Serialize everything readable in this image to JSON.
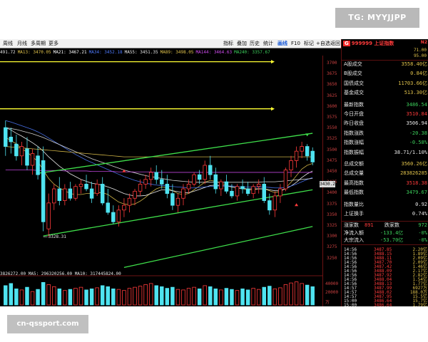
{
  "watermark_badge": "TG: MYYJJPP",
  "site_watermark": "cn-qssport.com",
  "toolbar": {
    "left_items": [
      "周线",
      "月线",
      "多周期",
      "更多"
    ],
    "right_items": [
      "指标",
      "叠加",
      "历史",
      "统计",
      "画线",
      "F10",
      "标记",
      "+自选",
      "返回"
    ],
    "active_item": "画线"
  },
  "ma_legend": [
    {
      "text": "491.72",
      "color": "#e6e6e6"
    },
    {
      "text": "MA13: 3470.05",
      "color": "#e0c24b"
    },
    {
      "text": "MA21: 3467.21",
      "color": "#ffffff"
    },
    {
      "text": "MA34: 3452.18",
      "color": "#4f7bff"
    },
    {
      "text": "MA55: 3451.35",
      "color": "#e6e6e6"
    },
    {
      "text": "MA89: 3498.05",
      "color": "#e0c24b"
    },
    {
      "text": "MA144: 3464.63",
      "color": "#d04cf0"
    },
    {
      "text": "MA240: 3357.67",
      "color": "#3ccf5b"
    }
  ],
  "price_axis": [
    "3700",
    "3675",
    "3650",
    "3625",
    "3600",
    "3575",
    "3550",
    "3525",
    "3500",
    "3475",
    "3450",
    "3425",
    "3400",
    "3375",
    "3350",
    "3325",
    "3300",
    "3275",
    "3250"
  ],
  "current_price_label": "3430.2",
  "low_annotation": "3328.31",
  "volume_legend": "3826272.00  MA5: 296320256.00  MA10: 317445824.00",
  "volume_axis": [
    "40000",
    "20000",
    "万"
  ],
  "panel": {
    "g_label": "G",
    "code": "999999 上证指数",
    "badge": "N2",
    "prices": [
      "71.00",
      "95.00"
    ],
    "stats": [
      {
        "label": "A股成交",
        "value": "3558.40亿",
        "color": "#e0c24b"
      },
      {
        "label": "B股成交",
        "value": "0.84亿",
        "color": "#e0c24b"
      },
      {
        "label": "国债成交",
        "value": "11703.66亿",
        "color": "#e0c24b"
      },
      {
        "label": "基金成交",
        "value": "513.30亿",
        "color": "#e0c24b"
      },
      {
        "label": "最新指数",
        "value": "3486.54",
        "color": "#3ccf5b"
      },
      {
        "label": "今日开盘",
        "value": "3510.84",
        "color": "#ff3b3b"
      },
      {
        "label": "昨日收盘",
        "value": "3506.94",
        "color": "#e6e6e6"
      },
      {
        "label": "指数涨跌",
        "value": "-20.38",
        "color": "#3ccf5b"
      },
      {
        "label": "指数涨幅",
        "value": "-0.58%",
        "color": "#3ccf5b"
      },
      {
        "label": "指数振幅",
        "value": "38.71/1.10%",
        "color": "#e6e6e6"
      },
      {
        "label": "总成交额",
        "value": "3560.26亿",
        "color": "#e0c24b"
      },
      {
        "label": "总成交量",
        "value": "283826285",
        "color": "#e0c24b"
      },
      {
        "label": "最高指数",
        "value": "3518.38",
        "color": "#ff3b3b"
      },
      {
        "label": "最低指数",
        "value": "3479.67",
        "color": "#3ccf5b"
      },
      {
        "label": "指数量比",
        "value": "0.92",
        "color": "#e6e6e6"
      },
      {
        "label": "上证换手",
        "value": "0.74%",
        "color": "#e6e6e6"
      }
    ],
    "breadth": {
      "up_label": "涨家数",
      "up_value": "891",
      "down_label": "跌家数",
      "down_value": "972"
    },
    "flows": [
      {
        "label": "净流入额",
        "value": "-133.4亿",
        "color": "#3ccf5b",
        "suffix": "-0%"
      },
      {
        "label": "大宗流入",
        "value": "-53.70亿",
        "color": "#3ccf5b",
        "suffix": "-0%"
      }
    ],
    "ticks": [
      {
        "time": "14:56",
        "price": "3487.85",
        "vol": "2.20亿"
      },
      {
        "time": "14:56",
        "price": "3488.15",
        "vol": "1.89亿"
      },
      {
        "time": "14:56",
        "price": "3488.11",
        "vol": "2.09亿"
      },
      {
        "time": "14:56",
        "price": "3487.70",
        "vol": "2.09亿"
      },
      {
        "time": "14:56",
        "price": "3487.42",
        "vol": "1.46亿"
      },
      {
        "time": "14:56",
        "price": "3488.09",
        "vol": "2.17亿"
      },
      {
        "time": "14:56",
        "price": "3487.92",
        "vol": "2.82亿"
      },
      {
        "time": "14:56",
        "price": "3488.04",
        "vol": "1.54亿"
      },
      {
        "time": "14:56",
        "price": "3488.13",
        "vol": "1.77亿"
      },
      {
        "time": "14:57",
        "price": "3487.99",
        "vol": "6927万"
      },
      {
        "time": "14:57",
        "price": "3488.02",
        "vol": "188.0万"
      },
      {
        "time": "14:57",
        "price": "3487.95",
        "vol": "15.5亿"
      },
      {
        "time": "15:00",
        "price": "3486.64",
        "vol": "15.7亿"
      },
      {
        "time": "15:00",
        "price": "3486.64",
        "vol": "1.79亿"
      }
    ]
  },
  "chart_data": {
    "type": "candlestick",
    "price_range": [
      3250,
      3710
    ],
    "candles": [
      {
        "o": 3560,
        "h": 3575,
        "l": 3500,
        "c": 3520
      },
      {
        "o": 3540,
        "h": 3560,
        "l": 3505,
        "c": 3530
      },
      {
        "o": 3525,
        "h": 3545,
        "l": 3490,
        "c": 3500
      },
      {
        "o": 3500,
        "h": 3530,
        "l": 3480,
        "c": 3520
      },
      {
        "o": 3515,
        "h": 3540,
        "l": 3470,
        "c": 3480
      },
      {
        "o": 3480,
        "h": 3515,
        "l": 3460,
        "c": 3505
      },
      {
        "o": 3500,
        "h": 3520,
        "l": 3450,
        "c": 3460
      },
      {
        "o": 3490,
        "h": 3520,
        "l": 3340,
        "c": 3360
      },
      {
        "o": 3345,
        "h": 3420,
        "l": 3328,
        "c": 3400
      },
      {
        "o": 3400,
        "h": 3440,
        "l": 3385,
        "c": 3430
      },
      {
        "o": 3430,
        "h": 3455,
        "l": 3395,
        "c": 3405
      },
      {
        "o": 3405,
        "h": 3440,
        "l": 3395,
        "c": 3430
      },
      {
        "o": 3430,
        "h": 3445,
        "l": 3405,
        "c": 3410
      },
      {
        "o": 3410,
        "h": 3440,
        "l": 3405,
        "c": 3435
      },
      {
        "o": 3435,
        "h": 3450,
        "l": 3420,
        "c": 3440
      },
      {
        "o": 3440,
        "h": 3460,
        "l": 3425,
        "c": 3430
      },
      {
        "o": 3430,
        "h": 3445,
        "l": 3400,
        "c": 3410
      },
      {
        "o": 3420,
        "h": 3450,
        "l": 3415,
        "c": 3440
      },
      {
        "o": 3440,
        "h": 3455,
        "l": 3395,
        "c": 3400
      },
      {
        "o": 3400,
        "h": 3430,
        "l": 3375,
        "c": 3380
      },
      {
        "o": 3380,
        "h": 3395,
        "l": 3355,
        "c": 3360
      },
      {
        "o": 3360,
        "h": 3395,
        "l": 3350,
        "c": 3385
      },
      {
        "o": 3385,
        "h": 3410,
        "l": 3370,
        "c": 3395
      },
      {
        "o": 3395,
        "h": 3420,
        "l": 3380,
        "c": 3410
      },
      {
        "o": 3410,
        "h": 3430,
        "l": 3395,
        "c": 3425
      },
      {
        "o": 3425,
        "h": 3450,
        "l": 3415,
        "c": 3440
      },
      {
        "o": 3440,
        "h": 3460,
        "l": 3430,
        "c": 3450
      },
      {
        "o": 3450,
        "h": 3475,
        "l": 3435,
        "c": 3465
      },
      {
        "o": 3465,
        "h": 3480,
        "l": 3440,
        "c": 3450
      },
      {
        "o": 3450,
        "h": 3470,
        "l": 3430,
        "c": 3440
      },
      {
        "o": 3440,
        "h": 3460,
        "l": 3410,
        "c": 3420
      },
      {
        "o": 3420,
        "h": 3440,
        "l": 3385,
        "c": 3395
      },
      {
        "o": 3395,
        "h": 3420,
        "l": 3380,
        "c": 3410
      },
      {
        "o": 3410,
        "h": 3440,
        "l": 3395,
        "c": 3430
      },
      {
        "o": 3430,
        "h": 3450,
        "l": 3420,
        "c": 3440
      },
      {
        "o": 3440,
        "h": 3465,
        "l": 3435,
        "c": 3460
      },
      {
        "o": 3460,
        "h": 3470,
        "l": 3440,
        "c": 3450
      },
      {
        "o": 3450,
        "h": 3490,
        "l": 3440,
        "c": 3480
      },
      {
        "o": 3480,
        "h": 3500,
        "l": 3450,
        "c": 3460
      },
      {
        "o": 3460,
        "h": 3475,
        "l": 3420,
        "c": 3430
      },
      {
        "o": 3430,
        "h": 3450,
        "l": 3415,
        "c": 3445
      },
      {
        "o": 3445,
        "h": 3460,
        "l": 3420,
        "c": 3425
      },
      {
        "o": 3425,
        "h": 3440,
        "l": 3410,
        "c": 3415
      },
      {
        "o": 3415,
        "h": 3440,
        "l": 3405,
        "c": 3435
      },
      {
        "o": 3435,
        "h": 3450,
        "l": 3420,
        "c": 3430
      },
      {
        "o": 3430,
        "h": 3445,
        "l": 3415,
        "c": 3420
      },
      {
        "o": 3420,
        "h": 3440,
        "l": 3410,
        "c": 3435
      },
      {
        "o": 3435,
        "h": 3450,
        "l": 3420,
        "c": 3440
      },
      {
        "o": 3440,
        "h": 3455,
        "l": 3400,
        "c": 3405
      },
      {
        "o": 3405,
        "h": 3420,
        "l": 3375,
        "c": 3385
      },
      {
        "o": 3385,
        "h": 3425,
        "l": 3370,
        "c": 3415
      },
      {
        "o": 3415,
        "h": 3440,
        "l": 3400,
        "c": 3430
      },
      {
        "o": 3430,
        "h": 3475,
        "l": 3425,
        "c": 3470
      },
      {
        "o": 3470,
        "h": 3500,
        "l": 3455,
        "c": 3490
      },
      {
        "o": 3490,
        "h": 3520,
        "l": 3475,
        "c": 3510
      },
      {
        "o": 3510,
        "h": 3530,
        "l": 3495,
        "c": 3520
      },
      {
        "o": 3520,
        "h": 3525,
        "l": 3490,
        "c": 3500
      },
      {
        "o": 3510,
        "h": 3518,
        "l": 3480,
        "c": 3487
      }
    ],
    "volume": [
      36,
      40,
      30,
      28,
      33,
      25,
      29,
      42,
      38,
      34,
      30,
      27,
      29,
      31,
      33,
      28,
      30,
      32,
      36,
      34,
      30,
      29,
      27,
      31,
      33,
      35,
      38,
      40,
      36,
      34,
      31,
      33,
      29,
      28,
      31,
      33,
      30,
      36,
      34,
      30,
      28,
      31,
      29,
      27,
      30,
      28,
      31,
      29,
      33,
      35,
      30,
      32,
      38,
      41,
      43,
      40,
      37,
      34
    ],
    "ma_lines": [
      {
        "name": "MA13",
        "color": "#e0c24b",
        "values": [
          3540,
          3532,
          3526,
          3515,
          3508,
          3498,
          3488,
          3470,
          3452,
          3440,
          3432,
          3426,
          3420,
          3418,
          3418,
          3420,
          3420,
          3422,
          3422,
          3418,
          3410,
          3402,
          3398,
          3396,
          3398,
          3404,
          3412,
          3422,
          3430,
          3434,
          3432,
          3426,
          3420,
          3418,
          3420,
          3428,
          3436,
          3444,
          3448,
          3446,
          3442,
          3438,
          3434,
          3432,
          3430,
          3428,
          3428,
          3430,
          3430,
          3426,
          3422,
          3424,
          3432,
          3444,
          3458,
          3472,
          3480,
          3484
        ]
      },
      {
        "name": "MA21",
        "color": "#ffffff",
        "values": [
          3560,
          3555,
          3548,
          3542,
          3535,
          3528,
          3520,
          3510,
          3498,
          3488,
          3478,
          3470,
          3462,
          3456,
          3450,
          3446,
          3442,
          3440,
          3438,
          3434,
          3430,
          3425,
          3420,
          3417,
          3415,
          3415,
          3416,
          3420,
          3424,
          3428,
          3428,
          3426,
          3424,
          3422,
          3422,
          3425,
          3429,
          3433,
          3437,
          3438,
          3437,
          3436,
          3434,
          3432,
          3431,
          3430,
          3430,
          3430,
          3430,
          3428,
          3426,
          3426,
          3430,
          3436,
          3444,
          3454,
          3462,
          3468
        ]
      },
      {
        "name": "MA34",
        "color": "#4f7bff",
        "values": [
          3575,
          3572,
          3568,
          3564,
          3560,
          3556,
          3551,
          3545,
          3538,
          3531,
          3524,
          3517,
          3510,
          3503,
          3497,
          3491,
          3486,
          3481,
          3476,
          3471,
          3466,
          3461,
          3456,
          3452,
          3448,
          3445,
          3442,
          3440,
          3438,
          3437,
          3436,
          3435,
          3434,
          3433,
          3432,
          3432,
          3433,
          3434,
          3435,
          3436,
          3436,
          3436,
          3436,
          3435,
          3434,
          3434,
          3434,
          3434,
          3434,
          3433,
          3432,
          3432,
          3433,
          3436,
          3440,
          3445,
          3450,
          3454
        ]
      },
      {
        "name": "MA55",
        "color": "#e6e6e6",
        "values": [
          3560,
          3558,
          3556,
          3553,
          3550,
          3547,
          3543,
          3539,
          3534,
          3529,
          3524,
          3519,
          3514,
          3509,
          3504,
          3499,
          3494,
          3490,
          3486,
          3482,
          3478,
          3474,
          3470,
          3467,
          3464,
          3461,
          3458,
          3456,
          3454,
          3452,
          3450,
          3448,
          3447,
          3446,
          3445,
          3444,
          3444,
          3444,
          3444,
          3444,
          3444,
          3444,
          3444,
          3444,
          3444,
          3444,
          3444,
          3444,
          3445,
          3445,
          3445,
          3446,
          3447,
          3448,
          3449,
          3450,
          3451,
          3452
        ]
      },
      {
        "name": "MA89",
        "color": "#e0c24b",
        "values": [
          3520,
          3519,
          3518,
          3517,
          3516,
          3515,
          3514,
          3513,
          3512,
          3511,
          3510,
          3509,
          3508,
          3507,
          3506,
          3505,
          3504,
          3503,
          3502,
          3501,
          3500,
          3499,
          3498,
          3498,
          3498,
          3498,
          3498,
          3498,
          3498,
          3498,
          3498,
          3498,
          3498,
          3498,
          3498,
          3498,
          3498,
          3498,
          3498,
          3498,
          3498,
          3498,
          3498,
          3498,
          3498,
          3498,
          3498,
          3498,
          3498,
          3498,
          3498,
          3498,
          3498,
          3498,
          3498,
          3498,
          3498,
          3498
        ]
      },
      {
        "name": "MA144",
        "color": "#d04cf0",
        "values": [
          3470,
          3470,
          3470,
          3470,
          3470,
          3470,
          3469,
          3469,
          3469,
          3469,
          3469,
          3468,
          3468,
          3468,
          3468,
          3468,
          3467,
          3467,
          3467,
          3467,
          3467,
          3466,
          3466,
          3466,
          3466,
          3466,
          3466,
          3466,
          3465,
          3465,
          3465,
          3465,
          3465,
          3465,
          3465,
          3465,
          3465,
          3465,
          3465,
          3465,
          3465,
          3465,
          3465,
          3465,
          3465,
          3465,
          3465,
          3465,
          3465,
          3465,
          3465,
          3465,
          3465,
          3465,
          3465,
          3465,
          3465,
          3465
        ]
      }
    ],
    "horizontal_lines": [
      {
        "value": 3700,
        "color": "#ffff33"
      },
      {
        "value": 3600,
        "color": "#ffff33"
      }
    ],
    "channel_lines": [
      {
        "from": {
          "i": 6,
          "v": 3463
        },
        "to": {
          "i": 57,
          "v": 3548
        },
        "color": "#3fe04b"
      },
      {
        "from": {
          "i": 7,
          "v": 3330
        },
        "to": {
          "i": 57,
          "v": 3428
        },
        "color": "#3fe04b"
      },
      {
        "from": {
          "i": 22,
          "v": 3263
        },
        "to": {
          "i": 57,
          "v": 3350
        },
        "color": "#3fe04b"
      }
    ],
    "markers": [
      {
        "i": 56,
        "v": 3543,
        "dir": "down",
        "color": "#3fe04b"
      },
      {
        "i": 22,
        "v": 3470,
        "dir": "up",
        "color": "#ff3b3b"
      },
      {
        "i": 54,
        "v": 3398,
        "dir": "up",
        "color": "#ff3b3b"
      }
    ]
  }
}
